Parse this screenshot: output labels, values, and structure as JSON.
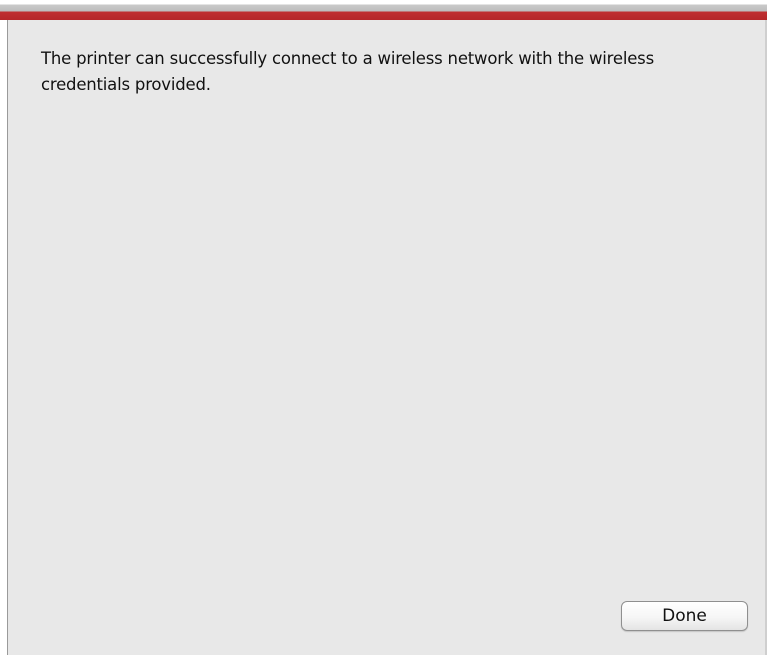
{
  "dialog": {
    "message": "The printer can successfully connect to a wireless network with the wireless credentials provided.",
    "done_label": "Done"
  },
  "colors": {
    "accent_bar": "#b52729",
    "background": "#e8e8e8"
  }
}
